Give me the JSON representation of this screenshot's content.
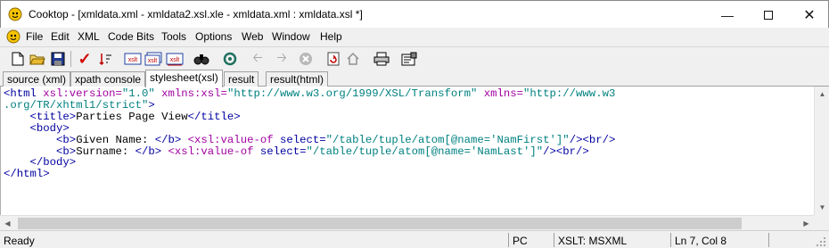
{
  "window": {
    "title": "Cooktop - [xmldata.xml - xmldata2.xsl.xle - xmldata.xml : xmldata.xsl *]"
  },
  "menu": [
    "File",
    "Edit",
    "XML",
    "Code Bits",
    "Tools",
    "Options",
    "Web",
    "Window",
    "Help"
  ],
  "toolbar": {
    "icons": [
      "new-icon",
      "open-icon",
      "save-icon",
      "check-icon",
      "sort-icon",
      "xslt-icon",
      "xslt-multi-icon",
      "xslt-run-icon",
      "find-icon",
      "refresh-icon",
      "back-icon",
      "forward-icon",
      "stop-icon",
      "reload-icon",
      "home-icon",
      "print-icon",
      "properties-icon"
    ],
    "xslt_label": "xslt"
  },
  "tabs": [
    "source (xml)",
    "xpath console",
    "stylesheet(xsl)",
    "result",
    "result(html)"
  ],
  "active_tab": "stylesheet(xsl)",
  "code": {
    "line1a": "<html",
    "line1b": " xsl:version=",
    "line1c": "\"1.0\"",
    "line1d": " xmlns:xsl=",
    "line1e": "\"http://www.w3.org/1999/XSL/Transform\"",
    "line1f": " xmlns=",
    "line1g": "\"http://www.w3",
    "line2": ".org/TR/xhtml1/strict\"",
    "line2end": ">",
    "line3a": "    <title>",
    "line3b": "Parties Page View",
    "line3c": "</title>",
    "line4": "    <body>",
    "line5a": "        <b>",
    "line5b": "Given Name: ",
    "line5c": "</b> ",
    "line5d": "<xsl:value-of",
    "line5e": " select=",
    "line5f": "\"/table/tuple/atom[@name='NamFirst']\"",
    "line5g": "/><br/>",
    "line6a": "        <b>",
    "line6b": "Surname: ",
    "line6c": "</b> ",
    "line6d": "<xsl:value-of",
    "line6e": " select=",
    "line6f": "\"/table/tuple/atom[@name='NamLast']\"",
    "line6g": "/><br/>",
    "line7": "    </body>",
    "line8": "</html>"
  },
  "status": {
    "left": "Ready",
    "mode": "PC",
    "processor": "XSLT: MSXML",
    "position": "Ln 7, Col 8"
  }
}
